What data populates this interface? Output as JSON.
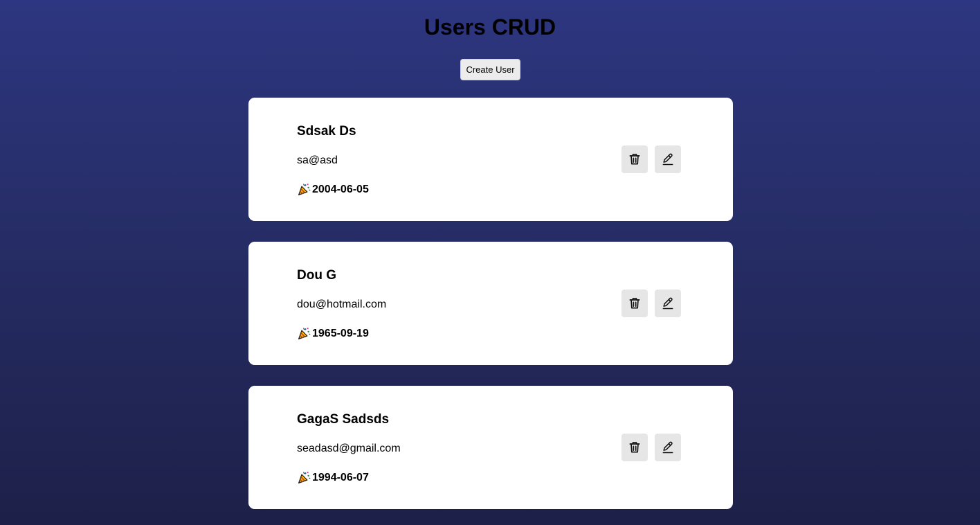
{
  "header": {
    "title": "Users CRUD",
    "create_label": "Create User"
  },
  "users": [
    {
      "name": "Sdsak Ds",
      "email": "sa@asd",
      "birthdate": "2004-06-05"
    },
    {
      "name": "Dou G",
      "email": "dou@hotmail.com",
      "birthdate": "1965-09-19"
    },
    {
      "name": "GagaS Sadsds",
      "email": "seadasd@gmail.com",
      "birthdate": "1994-06-07"
    }
  ],
  "icons": {
    "birthdate": "party-popper-icon",
    "delete": "trash-icon",
    "edit": "pencil-icon"
  },
  "colors": {
    "background_top": "#2d3680",
    "background_bottom": "#1d2048",
    "card": "#ffffff",
    "icon_button": "#e6e6e6"
  }
}
